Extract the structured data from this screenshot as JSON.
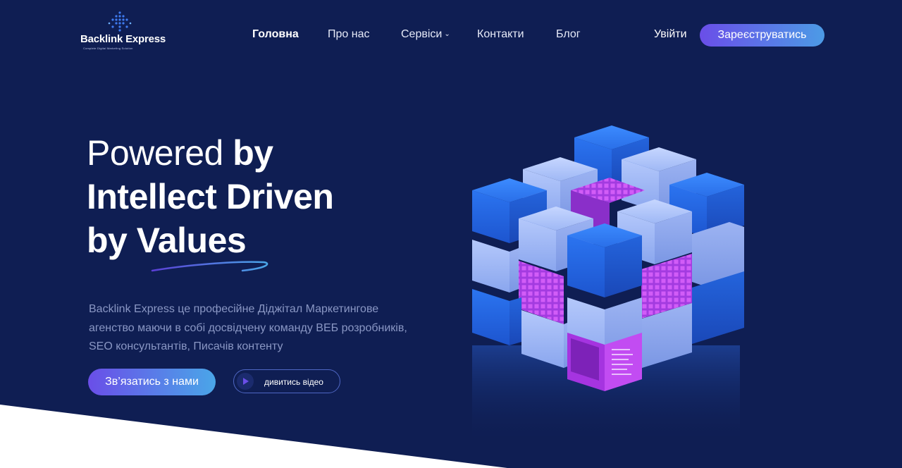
{
  "brand": {
    "name": "Backlink Express",
    "tagline": "Complete Digital Marketing Solution"
  },
  "nav": {
    "items": [
      {
        "label": "Головна",
        "active": true
      },
      {
        "label": "Про нас",
        "active": false
      },
      {
        "label": "Сервіси",
        "active": false,
        "dropdown": true
      },
      {
        "label": "Контакти",
        "active": false
      },
      {
        "label": "Блог",
        "active": false
      }
    ],
    "login_label": "Увійти",
    "signup_label": "Зареєструватись"
  },
  "hero": {
    "line1_regular": "Powered ",
    "line1_bold": "by",
    "line2_bold": "Intellect Driven",
    "line3_regular": "by ",
    "line3_bold": "Values",
    "description": "Backlink Express це професійне Діджітал Маркетингове агенство маючи в собі досвідчену команду ВЕБ розробників, SEO консультантів, Писачів контенту",
    "cta_label": "Зв’язатись з нами",
    "video_label": "дивитись відео"
  },
  "colors": {
    "background": "#0f1e53",
    "accent_purple": "#6a4ee8",
    "accent_blue": "#4aa6e8",
    "muted_text": "#8a97c4"
  },
  "icons": {
    "logo": "dot-grid-logo-icon",
    "chevron": "chevron-down-icon",
    "play": "play-icon"
  }
}
